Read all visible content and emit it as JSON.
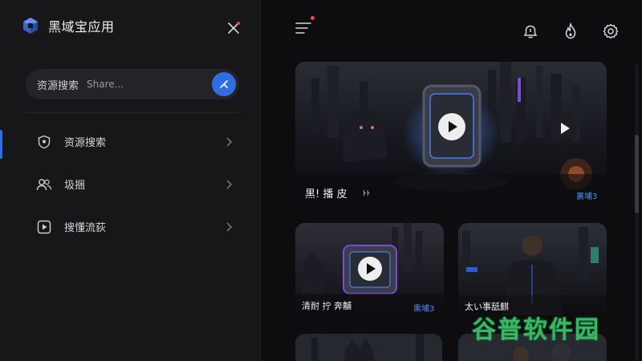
{
  "brand": {
    "title": "黑域宝应用",
    "logo_icon": "cube-logo-icon"
  },
  "search": {
    "label": "资源搜索",
    "placeholder": "Share...",
    "button_icon": "search-icon"
  },
  "sidebar": {
    "items": [
      {
        "label": "资源搜索",
        "icon": "shield-icon"
      },
      {
        "label": "圾捆",
        "icon": "users-icon"
      },
      {
        "label": "搜懂流荻",
        "icon": "play-square-icon"
      }
    ]
  },
  "topbar": {
    "has_notification": true
  },
  "cards": [
    {
      "title": "黒! 播 皮",
      "suffix": "ﾄﾄ",
      "tag": "裏埔3"
    },
    {
      "title": "清耐 拧 奔黼",
      "tag": "熏埔3"
    },
    {
      "title": "太い事舐麒",
      "tag": ""
    },
    {
      "title": "",
      "tag": ""
    },
    {
      "title": "",
      "tag": ""
    }
  ],
  "watermark": "谷普软件园",
  "colors": {
    "accent": "#2f6ee0",
    "tag": "#4b8ff0",
    "notification": "#f04848",
    "watermark": "#3fb36a"
  }
}
